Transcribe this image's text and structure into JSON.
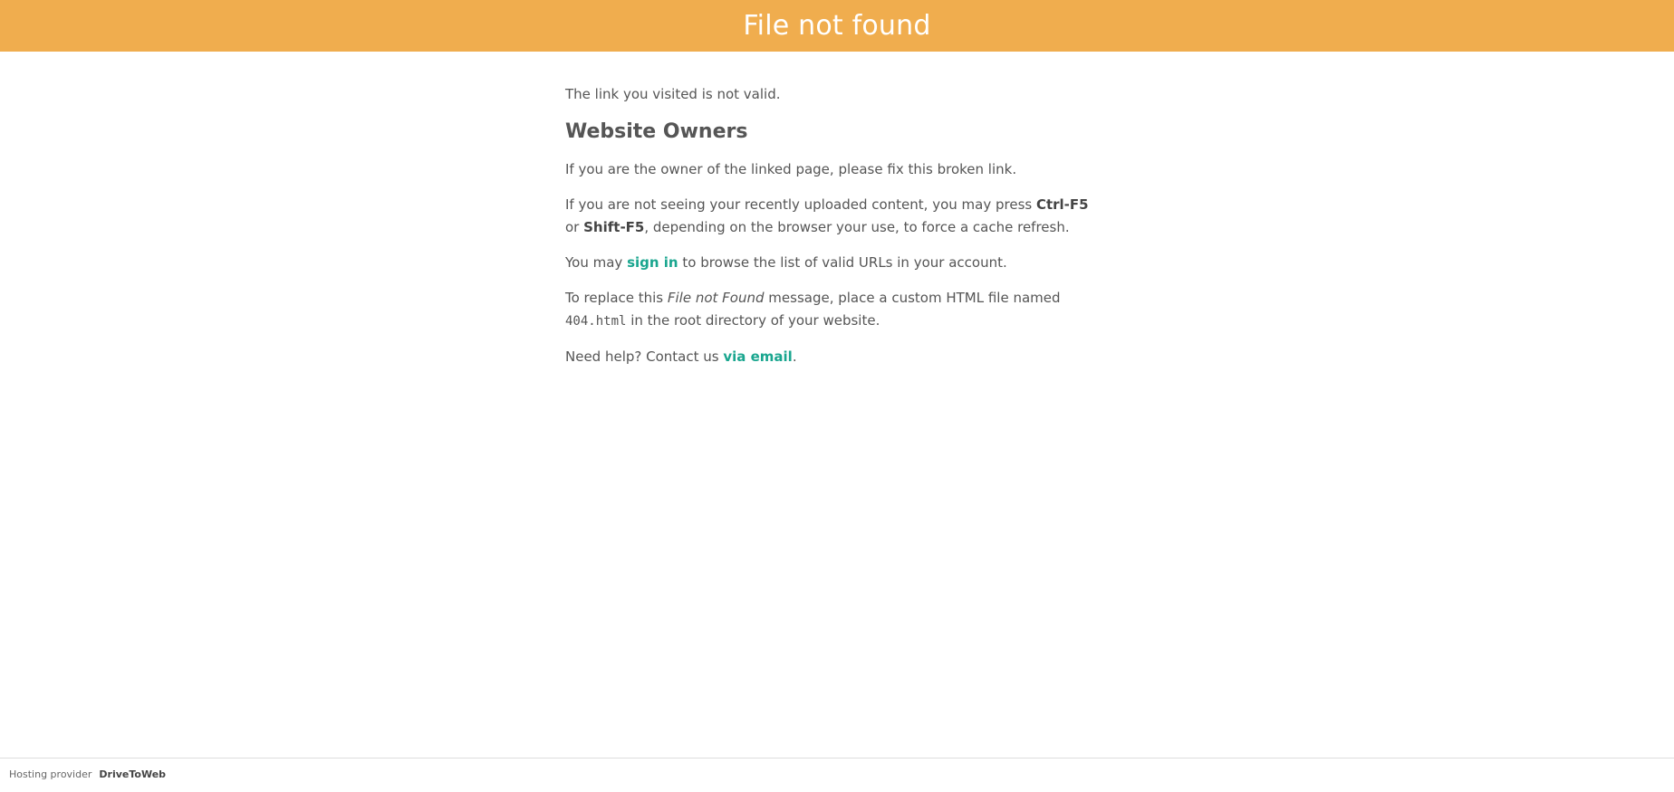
{
  "header": {
    "title": "File not found",
    "background_color": "#f0ad4e"
  },
  "content": {
    "intro": "The link you visited is not valid.",
    "heading": "Website Owners",
    "p1": "If you are the owner of the linked page, please fix this broken link.",
    "p2": {
      "text_before": "If you are not seeing your recently uploaded content, you may press ",
      "key1": "Ctrl-F5",
      "or": " or ",
      "key2": "Shift-F5",
      "text_after": ", depending on the browser your use, to force a cache refresh."
    },
    "p3": {
      "text_before": "You may ",
      "link": "sign in",
      "text_after": " to browse the list of valid URLs in your account."
    },
    "p4": {
      "text_before": "To replace this ",
      "italic": "File not Found",
      "text_middle": " message, place a custom HTML file named ",
      "code": "404.html",
      "text_after": " in the root directory of your website."
    },
    "p5": {
      "text_before": "Need help? Contact us ",
      "link": "via email",
      "text_after": "."
    },
    "link_color": "#1aa68f"
  },
  "footer": {
    "label": "Hosting provider",
    "provider": "DriveToWeb"
  }
}
